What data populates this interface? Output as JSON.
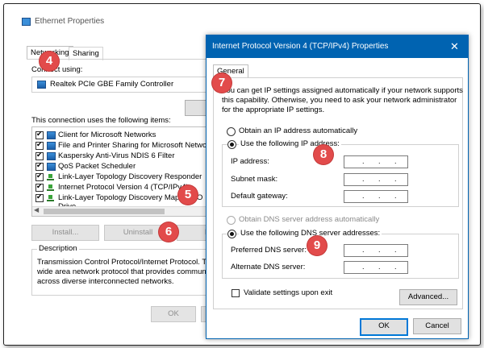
{
  "ethernet_window": {
    "title": "Ethernet Properties",
    "tabs": [
      "Networking",
      "Sharing"
    ],
    "connect_using_label": "Connect using:",
    "adapter_name": "Realtek PCIe GBE Family Controller",
    "configure_button": "Con",
    "items_label": "This connection uses the following items:",
    "items": [
      {
        "label": "Client for Microsoft Networks",
        "checked": true
      },
      {
        "label": "File and Printer Sharing for Microsoft Networks",
        "checked": true
      },
      {
        "label": "Kaspersky Anti-Virus NDIS 6 Filter",
        "checked": true
      },
      {
        "label": "QoS Packet Scheduler",
        "checked": true
      },
      {
        "label": "Link-Layer Topology Discovery Responder",
        "checked": true
      },
      {
        "label": "Internet Protocol Version 4 (TCP/IPv4)",
        "checked": true
      },
      {
        "label": "Link-Layer Topology Discovery Mapper I/O Drive",
        "checked": true
      }
    ],
    "install_button": "Install...",
    "uninstall_button": "Uninstall",
    "properties_button": "Prop",
    "description_label": "Description",
    "description_lines": [
      "Transmission Control Protocol/Internet Protocol. The d",
      "wide area network protocol that provides communicati",
      "across diverse interconnected networks."
    ],
    "ok_button": "OK",
    "cancel_button": "C"
  },
  "ipv4_window": {
    "title": "Internet Protocol Version 4 (TCP/IPv4) Properties",
    "tab": "General",
    "intro_lines": [
      "You can get IP settings assigned automatically if your network supports",
      "this capability. Otherwise, you need to ask your network administrator",
      "for the appropriate IP settings."
    ],
    "obtain_ip_auto": "Obtain an IP address automatically",
    "use_following_ip": "Use the following IP address:",
    "ip_address_label": "IP address:",
    "subnet_mask_label": "Subnet mask:",
    "default_gateway_label": "Default gateway:",
    "obtain_dns_auto": "Obtain DNS server address automatically",
    "use_following_dns": "Use the following DNS server addresses:",
    "preferred_dns_label": "Preferred DNS server:",
    "alternate_dns_label": "Alternate DNS server:",
    "validate_label": "Validate settings upon exit",
    "advanced_button": "Advanced...",
    "ok_button": "OK",
    "cancel_button": "Cancel",
    "close_glyph": "✕",
    "ip_dot": "."
  },
  "badges": [
    "4",
    "5",
    "6",
    "7",
    "8",
    "9"
  ],
  "colors": {
    "titlebar_active": "#0063b1",
    "badge": "#e24b4b"
  }
}
